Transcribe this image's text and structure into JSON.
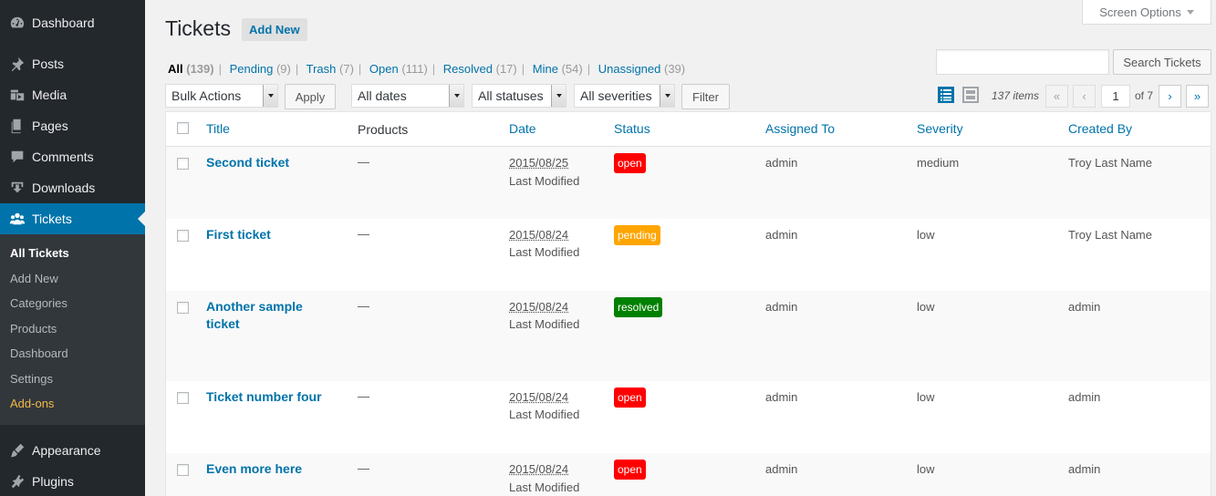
{
  "sidebar": {
    "menu_top": [
      {
        "label": "Dashboard",
        "icon": "dashboard-icon"
      },
      {
        "label": "Posts",
        "icon": "pin-icon"
      },
      {
        "label": "Media",
        "icon": "media-icon"
      },
      {
        "label": "Pages",
        "icon": "pages-icon"
      },
      {
        "label": "Comments",
        "icon": "comment-icon"
      },
      {
        "label": "Downloads",
        "icon": "download-icon"
      },
      {
        "label": "Tickets",
        "icon": "users-icon"
      }
    ],
    "submenu": [
      "All Tickets",
      "Add New",
      "Categories",
      "Products",
      "Dashboard",
      "Settings",
      "Add-ons"
    ],
    "menu_bottom": [
      {
        "label": "Appearance",
        "icon": "brush-icon"
      },
      {
        "label": "Plugins",
        "icon": "plugin-icon"
      }
    ]
  },
  "header": {
    "screen_options": "Screen Options",
    "title": "Tickets",
    "add_new": "Add New"
  },
  "views": [
    {
      "label": "All",
      "count": "(139)"
    },
    {
      "label": "Pending",
      "count": "(9)"
    },
    {
      "label": "Trash",
      "count": "(7)"
    },
    {
      "label": "Open",
      "count": "(111)"
    },
    {
      "label": "Resolved",
      "count": "(17)"
    },
    {
      "label": "Mine",
      "count": "(54)"
    },
    {
      "label": "Unassigned",
      "count": "(39)"
    }
  ],
  "search": {
    "placeholder": "",
    "button": "Search Tickets"
  },
  "toolbar": {
    "bulk_actions": "Bulk Actions",
    "apply": "Apply",
    "dates": "All dates",
    "statuses": "All statuses",
    "severities": "All severities",
    "filter": "Filter"
  },
  "pagination": {
    "items": "137 items",
    "first": "«",
    "prev": "‹",
    "current_page": "1",
    "of": "of 7",
    "next": "›",
    "last": "»"
  },
  "table": {
    "columns": [
      "Title",
      "Products",
      "Date",
      "Status",
      "Assigned To",
      "Severity",
      "Created By"
    ],
    "rows": [
      {
        "title": "Second ticket",
        "products": "—",
        "date": "2015/08/25",
        "modified": "Last Modified",
        "status": "open",
        "status_color": "#ff0000",
        "assigned": "admin",
        "severity": "medium",
        "created_by": "Troy Last Name"
      },
      {
        "title": "First ticket",
        "products": "—",
        "date": "2015/08/24",
        "modified": "Last Modified",
        "status": "pending",
        "status_color": "#ffa500",
        "assigned": "admin",
        "severity": "low",
        "created_by": "Troy Last Name"
      },
      {
        "title": "Another sample ticket",
        "products": "—",
        "date": "2015/08/24",
        "modified": "Last Modified",
        "status": "resolved",
        "status_color": "#008000",
        "assigned": "admin",
        "severity": "low",
        "created_by": "admin"
      },
      {
        "title": "Ticket number four",
        "products": "—",
        "date": "2015/08/24",
        "modified": "Last Modified",
        "status": "open",
        "status_color": "#ff0000",
        "assigned": "admin",
        "severity": "low",
        "created_by": "admin"
      },
      {
        "title": "Even more here",
        "products": "—",
        "date": "2015/08/24",
        "modified": "Last Modified",
        "status": "open",
        "status_color": "#ff0000",
        "assigned": "admin",
        "severity": "low",
        "created_by": "admin"
      }
    ]
  }
}
